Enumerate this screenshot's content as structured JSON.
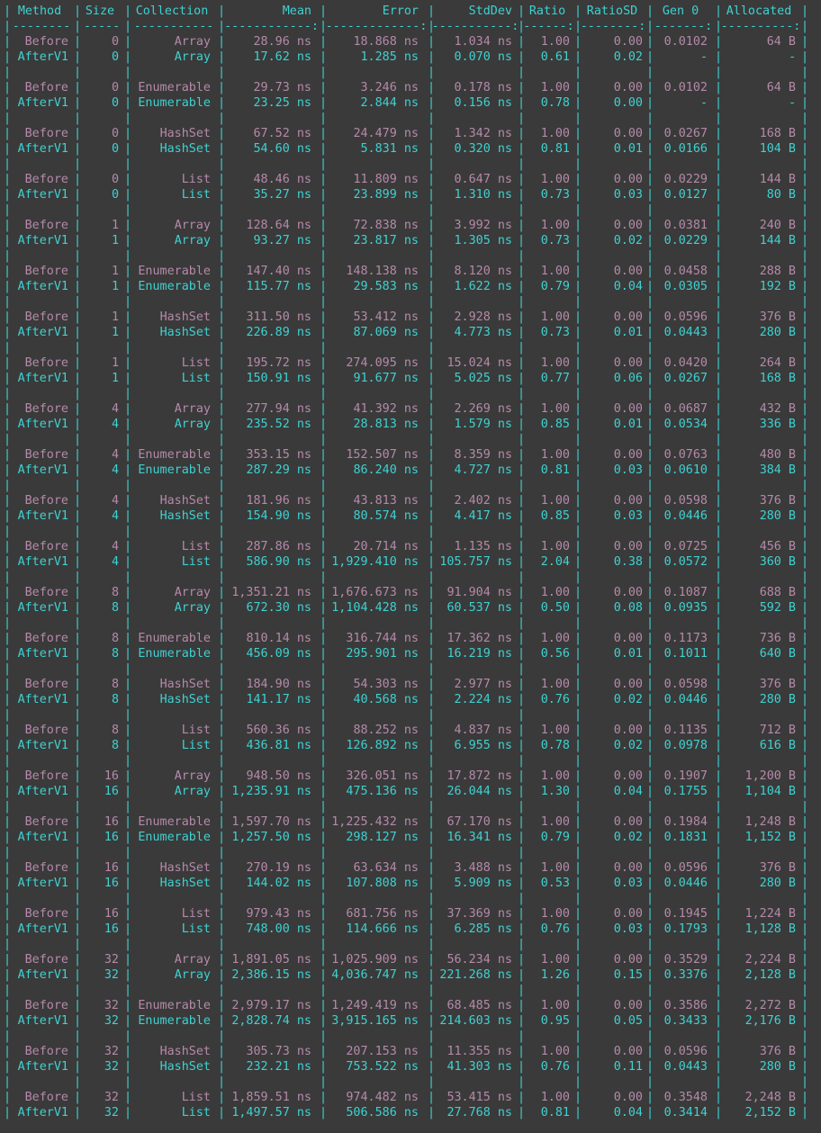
{
  "headers": [
    "Method",
    "Size",
    "Collection",
    "Mean",
    "Error",
    "StdDev",
    "Ratio",
    "RatioSD",
    "Gen 0",
    "Allocated"
  ],
  "separators": [
    "--------",
    "-----",
    "-----------",
    "------------:",
    "-------------:",
    "-----------:",
    "------:",
    "--------:",
    "-------:",
    "----------:"
  ],
  "colors": {
    "background": "#3a3a3a",
    "cyan": "#3fd1d1",
    "mauve": "#b58aa9"
  },
  "groups": [
    [
      [
        "Before",
        "0",
        "Array",
        "28.96 ns",
        "18.868 ns",
        "1.034 ns",
        "1.00",
        "0.00",
        "0.0102",
        "64 B"
      ],
      [
        "AfterV1",
        "0",
        "Array",
        "17.62 ns",
        "1.285 ns",
        "0.070 ns",
        "0.61",
        "0.02",
        "-",
        "-"
      ]
    ],
    [
      [
        "Before",
        "0",
        "Enumerable",
        "29.73 ns",
        "3.246 ns",
        "0.178 ns",
        "1.00",
        "0.00",
        "0.0102",
        "64 B"
      ],
      [
        "AfterV1",
        "0",
        "Enumerable",
        "23.25 ns",
        "2.844 ns",
        "0.156 ns",
        "0.78",
        "0.00",
        "-",
        "-"
      ]
    ],
    [
      [
        "Before",
        "0",
        "HashSet",
        "67.52 ns",
        "24.479 ns",
        "1.342 ns",
        "1.00",
        "0.00",
        "0.0267",
        "168 B"
      ],
      [
        "AfterV1",
        "0",
        "HashSet",
        "54.60 ns",
        "5.831 ns",
        "0.320 ns",
        "0.81",
        "0.01",
        "0.0166",
        "104 B"
      ]
    ],
    [
      [
        "Before",
        "0",
        "List",
        "48.46 ns",
        "11.809 ns",
        "0.647 ns",
        "1.00",
        "0.00",
        "0.0229",
        "144 B"
      ],
      [
        "AfterV1",
        "0",
        "List",
        "35.27 ns",
        "23.899 ns",
        "1.310 ns",
        "0.73",
        "0.03",
        "0.0127",
        "80 B"
      ]
    ],
    [
      [
        "Before",
        "1",
        "Array",
        "128.64 ns",
        "72.838 ns",
        "3.992 ns",
        "1.00",
        "0.00",
        "0.0381",
        "240 B"
      ],
      [
        "AfterV1",
        "1",
        "Array",
        "93.27 ns",
        "23.817 ns",
        "1.305 ns",
        "0.73",
        "0.02",
        "0.0229",
        "144 B"
      ]
    ],
    [
      [
        "Before",
        "1",
        "Enumerable",
        "147.40 ns",
        "148.138 ns",
        "8.120 ns",
        "1.00",
        "0.00",
        "0.0458",
        "288 B"
      ],
      [
        "AfterV1",
        "1",
        "Enumerable",
        "115.77 ns",
        "29.583 ns",
        "1.622 ns",
        "0.79",
        "0.04",
        "0.0305",
        "192 B"
      ]
    ],
    [
      [
        "Before",
        "1",
        "HashSet",
        "311.50 ns",
        "53.412 ns",
        "2.928 ns",
        "1.00",
        "0.00",
        "0.0596",
        "376 B"
      ],
      [
        "AfterV1",
        "1",
        "HashSet",
        "226.89 ns",
        "87.069 ns",
        "4.773 ns",
        "0.73",
        "0.01",
        "0.0443",
        "280 B"
      ]
    ],
    [
      [
        "Before",
        "1",
        "List",
        "195.72 ns",
        "274.095 ns",
        "15.024 ns",
        "1.00",
        "0.00",
        "0.0420",
        "264 B"
      ],
      [
        "AfterV1",
        "1",
        "List",
        "150.91 ns",
        "91.677 ns",
        "5.025 ns",
        "0.77",
        "0.06",
        "0.0267",
        "168 B"
      ]
    ],
    [
      [
        "Before",
        "4",
        "Array",
        "277.94 ns",
        "41.392 ns",
        "2.269 ns",
        "1.00",
        "0.00",
        "0.0687",
        "432 B"
      ],
      [
        "AfterV1",
        "4",
        "Array",
        "235.52 ns",
        "28.813 ns",
        "1.579 ns",
        "0.85",
        "0.01",
        "0.0534",
        "336 B"
      ]
    ],
    [
      [
        "Before",
        "4",
        "Enumerable",
        "353.15 ns",
        "152.507 ns",
        "8.359 ns",
        "1.00",
        "0.00",
        "0.0763",
        "480 B"
      ],
      [
        "AfterV1",
        "4",
        "Enumerable",
        "287.29 ns",
        "86.240 ns",
        "4.727 ns",
        "0.81",
        "0.03",
        "0.0610",
        "384 B"
      ]
    ],
    [
      [
        "Before",
        "4",
        "HashSet",
        "181.96 ns",
        "43.813 ns",
        "2.402 ns",
        "1.00",
        "0.00",
        "0.0598",
        "376 B"
      ],
      [
        "AfterV1",
        "4",
        "HashSet",
        "154.90 ns",
        "80.574 ns",
        "4.417 ns",
        "0.85",
        "0.03",
        "0.0446",
        "280 B"
      ]
    ],
    [
      [
        "Before",
        "4",
        "List",
        "287.86 ns",
        "20.714 ns",
        "1.135 ns",
        "1.00",
        "0.00",
        "0.0725",
        "456 B"
      ],
      [
        "AfterV1",
        "4",
        "List",
        "586.90 ns",
        "1,929.410 ns",
        "105.757 ns",
        "2.04",
        "0.38",
        "0.0572",
        "360 B"
      ]
    ],
    [
      [
        "Before",
        "8",
        "Array",
        "1,351.21 ns",
        "1,676.673 ns",
        "91.904 ns",
        "1.00",
        "0.00",
        "0.1087",
        "688 B"
      ],
      [
        "AfterV1",
        "8",
        "Array",
        "672.30 ns",
        "1,104.428 ns",
        "60.537 ns",
        "0.50",
        "0.08",
        "0.0935",
        "592 B"
      ]
    ],
    [
      [
        "Before",
        "8",
        "Enumerable",
        "810.14 ns",
        "316.744 ns",
        "17.362 ns",
        "1.00",
        "0.00",
        "0.1173",
        "736 B"
      ],
      [
        "AfterV1",
        "8",
        "Enumerable",
        "456.09 ns",
        "295.901 ns",
        "16.219 ns",
        "0.56",
        "0.01",
        "0.1011",
        "640 B"
      ]
    ],
    [
      [
        "Before",
        "8",
        "HashSet",
        "184.90 ns",
        "54.303 ns",
        "2.977 ns",
        "1.00",
        "0.00",
        "0.0598",
        "376 B"
      ],
      [
        "AfterV1",
        "8",
        "HashSet",
        "141.17 ns",
        "40.568 ns",
        "2.224 ns",
        "0.76",
        "0.02",
        "0.0446",
        "280 B"
      ]
    ],
    [
      [
        "Before",
        "8",
        "List",
        "560.36 ns",
        "88.252 ns",
        "4.837 ns",
        "1.00",
        "0.00",
        "0.1135",
        "712 B"
      ],
      [
        "AfterV1",
        "8",
        "List",
        "436.81 ns",
        "126.892 ns",
        "6.955 ns",
        "0.78",
        "0.02",
        "0.0978",
        "616 B"
      ]
    ],
    [
      [
        "Before",
        "16",
        "Array",
        "948.50 ns",
        "326.051 ns",
        "17.872 ns",
        "1.00",
        "0.00",
        "0.1907",
        "1,200 B"
      ],
      [
        "AfterV1",
        "16",
        "Array",
        "1,235.91 ns",
        "475.136 ns",
        "26.044 ns",
        "1.30",
        "0.04",
        "0.1755",
        "1,104 B"
      ]
    ],
    [
      [
        "Before",
        "16",
        "Enumerable",
        "1,597.70 ns",
        "1,225.432 ns",
        "67.170 ns",
        "1.00",
        "0.00",
        "0.1984",
        "1,248 B"
      ],
      [
        "AfterV1",
        "16",
        "Enumerable",
        "1,257.50 ns",
        "298.127 ns",
        "16.341 ns",
        "0.79",
        "0.02",
        "0.1831",
        "1,152 B"
      ]
    ],
    [
      [
        "Before",
        "16",
        "HashSet",
        "270.19 ns",
        "63.634 ns",
        "3.488 ns",
        "1.00",
        "0.00",
        "0.0596",
        "376 B"
      ],
      [
        "AfterV1",
        "16",
        "HashSet",
        "144.02 ns",
        "107.808 ns",
        "5.909 ns",
        "0.53",
        "0.03",
        "0.0446",
        "280 B"
      ]
    ],
    [
      [
        "Before",
        "16",
        "List",
        "979.43 ns",
        "681.756 ns",
        "37.369 ns",
        "1.00",
        "0.00",
        "0.1945",
        "1,224 B"
      ],
      [
        "AfterV1",
        "16",
        "List",
        "748.00 ns",
        "114.666 ns",
        "6.285 ns",
        "0.76",
        "0.03",
        "0.1793",
        "1,128 B"
      ]
    ],
    [
      [
        "Before",
        "32",
        "Array",
        "1,891.05 ns",
        "1,025.909 ns",
        "56.234 ns",
        "1.00",
        "0.00",
        "0.3529",
        "2,224 B"
      ],
      [
        "AfterV1",
        "32",
        "Array",
        "2,386.15 ns",
        "4,036.747 ns",
        "221.268 ns",
        "1.26",
        "0.15",
        "0.3376",
        "2,128 B"
      ]
    ],
    [
      [
        "Before",
        "32",
        "Enumerable",
        "2,979.17 ns",
        "1,249.419 ns",
        "68.485 ns",
        "1.00",
        "0.00",
        "0.3586",
        "2,272 B"
      ],
      [
        "AfterV1",
        "32",
        "Enumerable",
        "2,828.74 ns",
        "3,915.165 ns",
        "214.603 ns",
        "0.95",
        "0.05",
        "0.3433",
        "2,176 B"
      ]
    ],
    [
      [
        "Before",
        "32",
        "HashSet",
        "305.73 ns",
        "207.153 ns",
        "11.355 ns",
        "1.00",
        "0.00",
        "0.0596",
        "376 B"
      ],
      [
        "AfterV1",
        "32",
        "HashSet",
        "232.21 ns",
        "753.522 ns",
        "41.303 ns",
        "0.76",
        "0.11",
        "0.0443",
        "280 B"
      ]
    ],
    [
      [
        "Before",
        "32",
        "List",
        "1,859.51 ns",
        "974.482 ns",
        "53.415 ns",
        "1.00",
        "0.00",
        "0.3548",
        "2,248 B"
      ],
      [
        "AfterV1",
        "32",
        "List",
        "1,497.57 ns",
        "506.586 ns",
        "27.768 ns",
        "0.81",
        "0.04",
        "0.3414",
        "2,152 B"
      ]
    ]
  ]
}
